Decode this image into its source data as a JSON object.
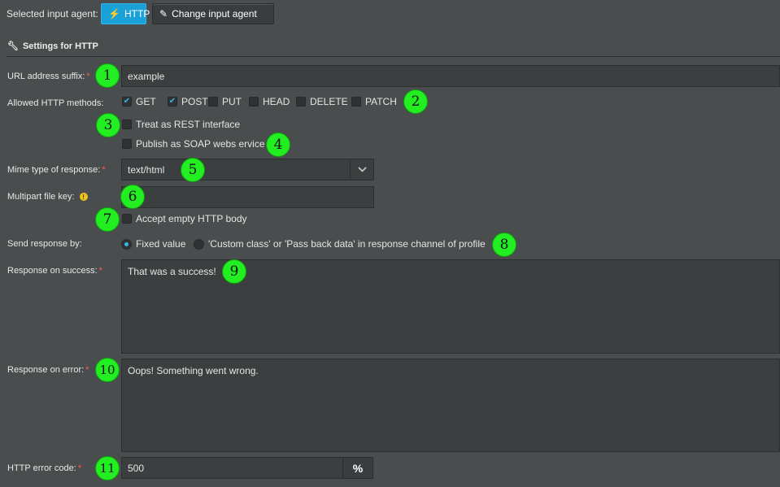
{
  "header": {
    "selected_label": "Selected input agent:",
    "http_button": "HTTP",
    "change_button": "Change input agent",
    "section_title": "Settings for HTTP"
  },
  "fields": {
    "url_suffix_label": "URL address suffix:",
    "url_suffix_value": "example",
    "methods_label": "Allowed HTTP methods:",
    "methods": [
      {
        "label": "GET",
        "checked": true
      },
      {
        "label": "POST",
        "checked": true
      },
      {
        "label": "PUT",
        "checked": false
      },
      {
        "label": "HEAD",
        "checked": false
      },
      {
        "label": "DELETE",
        "checked": false
      },
      {
        "label": "PATCH",
        "checked": false
      }
    ],
    "rest_label": "Treat as REST interface",
    "soap_label": "Publish as SOAP webs ervice",
    "mime_label": "Mime type of response:",
    "mime_value": "text/html",
    "multipart_label": "Multipart file key:",
    "multipart_value": "",
    "empty_body_label": "Accept empty HTTP body",
    "send_by_label": "Send response by:",
    "send_fixed": "Fixed value",
    "send_custom": "'Custom class' or 'Pass back data' in response channel of profile",
    "success_label": "Response on success:",
    "success_value": "That was a success!",
    "error_label": "Response on error:",
    "error_value": "Oops! Something went wrong.",
    "error_code_label": "HTTP error code:",
    "error_code_value": "500",
    "pct_button": "%"
  },
  "markers": [
    "1",
    "2",
    "3",
    "4",
    "5",
    "6",
    "7",
    "8",
    "9",
    "10",
    "11"
  ],
  "colors": {
    "background": "#4a4d4e",
    "accent": "#1aa2d8",
    "required": "#ff5a4e",
    "marker": "#22ee22"
  }
}
